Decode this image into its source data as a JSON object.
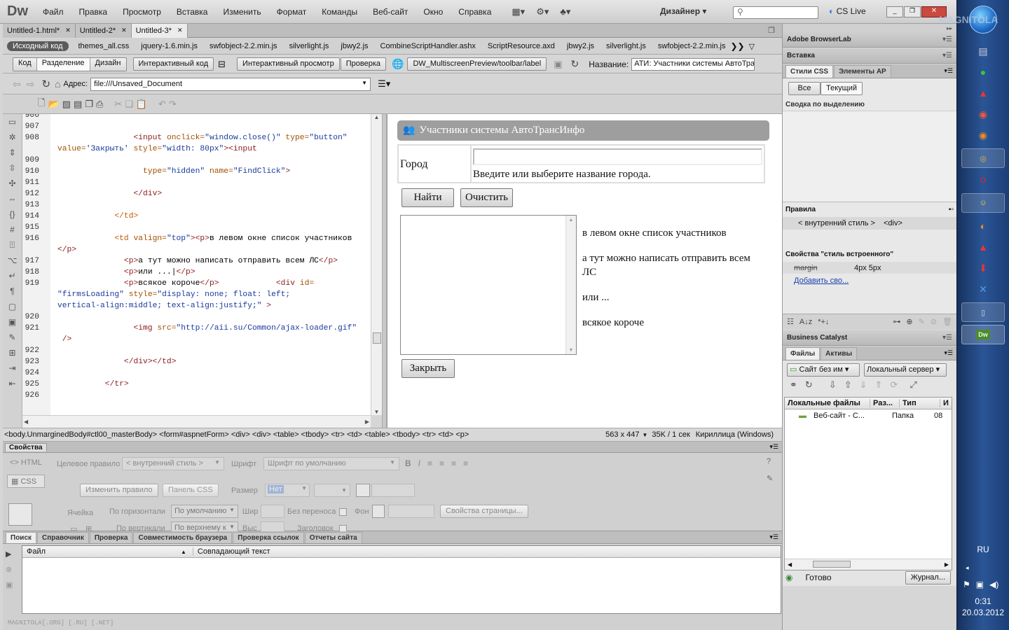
{
  "menubar": {
    "logo": "Dw",
    "items": [
      "Файл",
      "Правка",
      "Просмотр",
      "Вставка",
      "Изменить",
      "Формат",
      "Команды",
      "Веб-сайт",
      "Окно",
      "Справка"
    ],
    "workspace": "Дизайнер",
    "search_placeholder": "",
    "cslive": "CS Live",
    "watermark": "MAGNITOLA"
  },
  "doc_tabs": [
    "Untitled-1.html*",
    "Untitled-2*",
    "Untitled-3*"
  ],
  "related_files": {
    "source": "Исходный код",
    "files": [
      "themes_all.css",
      "jquery-1.6.min.js",
      "swfobject-2.2.min.js",
      "silverlight.js",
      "jbwy2.js",
      "CombineScriptHandler.ashx",
      "ScriptResource.axd",
      "jbwy2.js",
      "silverlight.js",
      "swfobject-2.2.min.js"
    ]
  },
  "doc_toolbar": {
    "code": "Код",
    "split": "Разделение",
    "design": "Дизайн",
    "live_code": "Интерактивный код",
    "live_view": "Интерактивный просмотр",
    "inspect": "Проверка",
    "multiscreen": "DW_MultiscreenPreview/toolbar/label",
    "title_label": "Название:",
    "title_value": "АТИ: Участники системы АвтоТрансИнфо"
  },
  "address": {
    "label": "Адрес:",
    "value": "file:///Unsaved_Document"
  },
  "code": {
    "lines": [
      {
        "n": "906",
        "t": ""
      },
      {
        "n": "907",
        "t": ""
      },
      {
        "n": "908",
        "h": [
          [
            "                ",
            ""
          ],
          [
            "<input ",
            "tg"
          ],
          [
            "onclick=",
            "at"
          ],
          [
            "\"window.close()\" ",
            "av"
          ],
          [
            "type=",
            "at"
          ],
          [
            "\"button\"",
            "av"
          ]
        ]
      },
      {
        "n": "",
        "h": [
          [
            "value=",
            "at"
          ],
          [
            "'Закрыть' ",
            "av"
          ],
          [
            "style=",
            "at"
          ],
          [
            "\"width: 80px\"",
            "av"
          ],
          [
            "><input",
            "tg"
          ]
        ]
      },
      {
        "n": "909",
        "t": ""
      },
      {
        "n": "910",
        "h": [
          [
            "                  ",
            ""
          ],
          [
            "type=",
            "at"
          ],
          [
            "\"hidden\" ",
            "av"
          ],
          [
            "name=",
            "at"
          ],
          [
            "\"FindClick\"",
            "av"
          ],
          [
            ">",
            "tg"
          ]
        ]
      },
      {
        "n": "911",
        "t": ""
      },
      {
        "n": "912",
        "h": [
          [
            "                ",
            ""
          ],
          [
            "</div>",
            "tg"
          ]
        ]
      },
      {
        "n": "913",
        "t": ""
      },
      {
        "n": "914",
        "h": [
          [
            "            ",
            ""
          ],
          [
            "</td>",
            "tgc"
          ]
        ]
      },
      {
        "n": "915",
        "t": ""
      },
      {
        "n": "916",
        "h": [
          [
            "            ",
            ""
          ],
          [
            "<td ",
            "tgc"
          ],
          [
            "valign=",
            "at"
          ],
          [
            "\"top\"",
            "av"
          ],
          [
            "><p>",
            "tg"
          ],
          [
            "в левом окне список участников",
            "tx"
          ]
        ]
      },
      {
        "n": "",
        "h": [
          [
            "</p>",
            "tg"
          ]
        ]
      },
      {
        "n": "917",
        "h": [
          [
            "              ",
            ""
          ],
          [
            "<p>",
            "tg"
          ],
          [
            "а тут можно написать отправить всем ЛС",
            "tx"
          ],
          [
            "</p>",
            "tg"
          ]
        ]
      },
      {
        "n": "918",
        "h": [
          [
            "              ",
            ""
          ],
          [
            "<p>",
            "tg"
          ],
          [
            "или ...|",
            "tx"
          ],
          [
            "</p>",
            "tg"
          ]
        ]
      },
      {
        "n": "919",
        "h": [
          [
            "              ",
            ""
          ],
          [
            "<p>",
            "tg"
          ],
          [
            "всякое короче",
            "tx"
          ],
          [
            "</p>",
            "tg"
          ],
          [
            "            ",
            ""
          ],
          [
            "<div ",
            "tg"
          ],
          [
            "id=",
            "at"
          ]
        ]
      },
      {
        "n": "",
        "h": [
          [
            "\"firmsLoading\" ",
            "av"
          ],
          [
            "style=",
            "at"
          ],
          [
            "\"display: none; float: left;",
            "av"
          ]
        ]
      },
      {
        "n": "",
        "h": [
          [
            "vertical-align:middle; text-align:justify;\" ",
            "av"
          ],
          [
            ">",
            "tg"
          ]
        ]
      },
      {
        "n": "920",
        "t": ""
      },
      {
        "n": "921",
        "h": [
          [
            "                ",
            ""
          ],
          [
            "<img ",
            "tg"
          ],
          [
            "src=",
            "at"
          ],
          [
            "\"http://aii.su/Common/ajax-loader.gif\"",
            "av"
          ]
        ]
      },
      {
        "n": "",
        "h": [
          [
            " />",
            "tg"
          ]
        ]
      },
      {
        "n": "922",
        "t": ""
      },
      {
        "n": "923",
        "h": [
          [
            "              ",
            ""
          ],
          [
            "</div></td>",
            "tg"
          ]
        ]
      },
      {
        "n": "924",
        "t": ""
      },
      {
        "n": "925",
        "h": [
          [
            "          ",
            ""
          ],
          [
            "</tr>",
            "tg"
          ]
        ]
      },
      {
        "n": "926",
        "t": ""
      }
    ]
  },
  "design": {
    "header": "Участники системы АвтоТрансИнфо",
    "city_label": "Город",
    "city_hint": "Введите или выберите название города.",
    "find": "Найти",
    "clear": "Очистить",
    "texts": [
      "в левом окне список участников",
      "а тут можно написать отправить всем ЛС",
      "или ...",
      "всякое короче"
    ],
    "close": "Закрыть"
  },
  "statusbar": {
    "tags": "<body.UnmarginedBody#ctl00_masterBody> <form#aspnetForm> <div> <div> <table> <tbody> <tr> <td> <table> <tbody> <tr> <td> <p>",
    "size": "563 x 447",
    "speed": "35K / 1 сек",
    "encoding": "Кириллица (Windows)"
  },
  "properties": {
    "title": "Свойства",
    "html": "HTML",
    "css": "CSS",
    "target_rule_label": "Целевое правило",
    "target_rule": "< внутренний стиль >",
    "font_label": "Шрифт",
    "font_value": "Шрифт по умолчанию",
    "edit_rule": "Изменить правило",
    "css_panel": "Панель CSS",
    "size_label": "Размер",
    "size_value": "Нет",
    "cell": "Ячейка",
    "horiz_label": "По горизонтали",
    "horiz_value": "По умолчанию",
    "vert_label": "По вертикали",
    "vert_value": "По верхнему к",
    "width_label": "Шир",
    "height_label": "Выс",
    "nowrap": "Без переноса",
    "header": "Заголовок",
    "bg_label": "Фон",
    "page_props": "Свойства страницы..."
  },
  "results": {
    "tabs": [
      "Поиск",
      "Справочник",
      "Проверка",
      "Совместимость браузера",
      "Проверка ссылок",
      "Отчеты сайта"
    ],
    "col_file": "Файл",
    "col_match": "Совпадающий текст",
    "footer": "MAGNITOLA[.ORG] [.RU] [.NET]"
  },
  "right": {
    "browserlab": "Adobe BrowserLab",
    "insert": "Вставка",
    "css_tab": "Стили CSS",
    "ap_tab": "Элементы AP",
    "all": "Все",
    "current": "Текущий",
    "summary": "Сводка по выделению",
    "rules": "Правила",
    "rule_a": "< внутренний стиль >",
    "rule_b": "<div>",
    "props_title": "Свойства \"стиль встроенного\"",
    "prop_name": "margin",
    "prop_value": "4px 5px",
    "add_prop": "Добавить сво...",
    "bc": "Business Catalyst",
    "files_tab": "Файлы",
    "assets_tab": "Активы",
    "site": "Сайт без им",
    "server": "Локальный сервер",
    "col_local": "Локальные файлы",
    "col_size": "Раз...",
    "col_type": "Тип",
    "col_mod": "И",
    "file_name": "Веб-сайт - С...",
    "file_type": "Папка",
    "file_mod": "08",
    "status": "Готово",
    "log": "Журнал..."
  },
  "taskbar": {
    "lang": "RU",
    "time": "0:31",
    "date": "20.03.2012"
  },
  "colors": {
    "accent": "#3a6ea5",
    "codebg": "#ffffff",
    "taskbar": "#1f3f78"
  }
}
